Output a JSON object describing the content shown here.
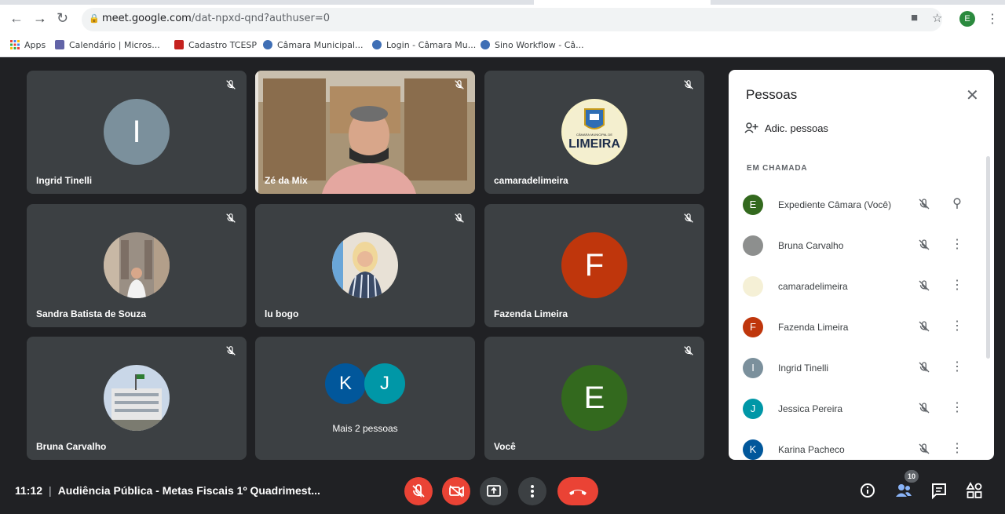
{
  "browser": {
    "url_host": "meet.google.com",
    "url_path": "/dat-npxd-qnd?authuser=0",
    "profile_initial": "E",
    "bookmarks": [
      {
        "label": "Apps",
        "color": "#1a73e8"
      },
      {
        "label": "Calendário | Micros...",
        "color": "#6264a7"
      },
      {
        "label": "Cadastro TCESP",
        "color": "#c5221f"
      },
      {
        "label": "Câmara Municipal...",
        "color": "#3f6fb5"
      },
      {
        "label": "Login - Câmara Mu...",
        "color": "#3f6fb5"
      },
      {
        "label": "Sino Workflow - Câ...",
        "color": "#3f6fb5"
      }
    ]
  },
  "tiles": [
    {
      "name": "Ingrid Tinelli",
      "initial": "I",
      "color": "#7b909c"
    },
    {
      "name": "Zé da Mix"
    },
    {
      "name": "camaradelimeira",
      "logo_text": "LIMEIRA",
      "logo_small": "CÂMARA MUNICIPAL DE"
    },
    {
      "name": "Sandra Batista de Souza"
    },
    {
      "name": "lu bogo"
    },
    {
      "name": "Fazenda Limeira",
      "initial": "F",
      "color": "#bf360c"
    },
    {
      "name": "Bruna Carvalho"
    },
    {
      "name": "Mais 2 pessoas",
      "initial_a": "K",
      "initial_b": "J",
      "color_a": "#01579b",
      "color_b": "#0097a7"
    },
    {
      "name": "Você",
      "initial": "E",
      "color": "#33691e"
    }
  ],
  "panel": {
    "title": "Pessoas",
    "add_label": "Adic. pessoas",
    "section": "EM CHAMADA",
    "people": [
      {
        "name": "Expediente Câmara (Você)",
        "initial": "E",
        "color": "#33691e",
        "action": "pin-icon"
      },
      {
        "name": "Bruna Carvalho",
        "initial": "",
        "color": "#8d8f8e",
        "action": "more-icon"
      },
      {
        "name": "camaradelimeira",
        "initial": "",
        "color": "#f5f0d6",
        "action": "more-icon"
      },
      {
        "name": "Fazenda Limeira",
        "initial": "F",
        "color": "#bf360c",
        "action": "more-icon"
      },
      {
        "name": "Ingrid Tinelli",
        "initial": "I",
        "color": "#7b909c",
        "action": "more-icon"
      },
      {
        "name": "Jessica Pereira",
        "initial": "J",
        "color": "#0097a7",
        "action": "more-icon"
      },
      {
        "name": "Karina Pacheco",
        "initial": "K",
        "color": "#01579b",
        "action": "more-icon"
      }
    ]
  },
  "bottom": {
    "time": "11:12",
    "meeting_title": "Audiência Pública - Metas Fiscais 1º Quadrimest...",
    "participant_count": "10"
  }
}
